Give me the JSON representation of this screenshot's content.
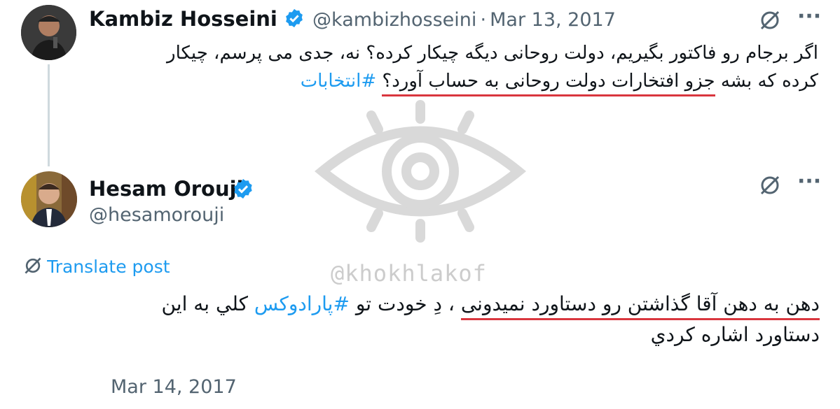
{
  "tweet1": {
    "author_name": "Kambiz Hosseini",
    "author_handle": "@kambizhosseini",
    "separator": "·",
    "date": "Mar 13, 2017",
    "line1": "اگر برجام رو فاکتور بگیریم، دولت روحانی دیگه چیکار کرده؟ نه، جدی می پرسم، چیکار",
    "line2_before_underline": "کرده که بشه ",
    "line2_underlined": "جزو افتخارات دولت روحانی به حساب آورد؟",
    "line2_hashtag": "#انتخابات",
    "more_label": "···"
  },
  "tweet2": {
    "author_name": "Hesam Orouji",
    "author_handle": "@hesamorouji",
    "translate_label": "Translate post",
    "line1_underlined": "دهن به دهن آقا گذاشتن رو دستاورد نمیدونی",
    "line1_rest": " ، دِ خودت تو ",
    "line1_hashtag": "#پارادوکس",
    "line1_end": " كلي به این",
    "line2": "دستاورد اشاره کردي",
    "date": "Mar 14, 2017",
    "more_label": "···"
  },
  "watermark": {
    "text": "@khokhlakof",
    "icon": "eye-icon"
  },
  "colors": {
    "verified": "#1d9bf0",
    "link": "#1d9bf0",
    "muted": "#536471",
    "underline": "#d9363e"
  }
}
